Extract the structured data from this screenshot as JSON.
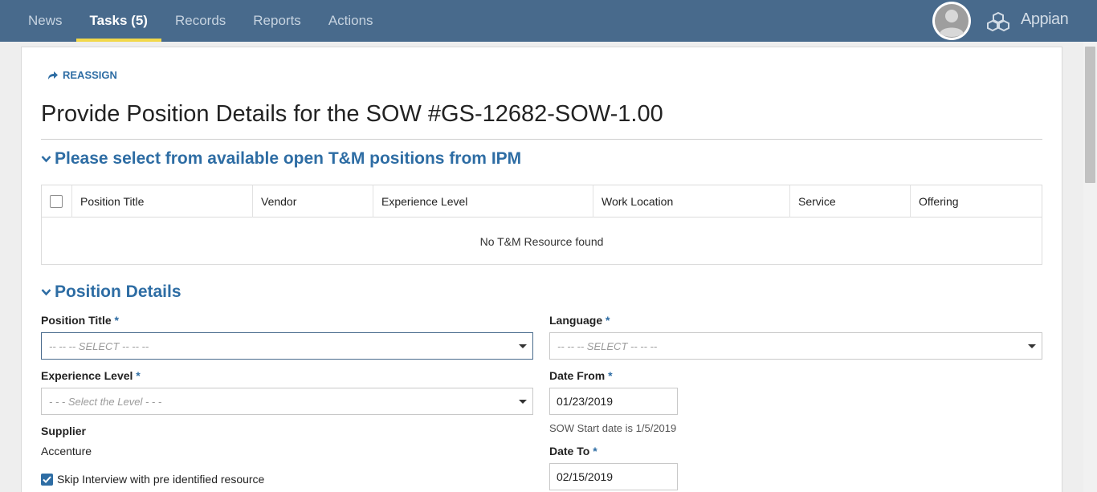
{
  "nav": {
    "tabs": [
      {
        "label": "News"
      },
      {
        "label": "Tasks (5)"
      },
      {
        "label": "Records"
      },
      {
        "label": "Reports"
      },
      {
        "label": "Actions"
      }
    ],
    "active_tab": "Tasks (5)",
    "logo": "Appian"
  },
  "task": {
    "reassign_label": "REASSIGN",
    "title": "Provide Position Details for the SOW #GS-12682-SOW-1.00"
  },
  "ipm_section": {
    "heading": "Please select from available open T&M positions from IPM",
    "columns": [
      "Position Title",
      "Vendor",
      "Experience Level",
      "Work Location",
      "Service",
      "Offering"
    ],
    "empty_message": "No T&M Resource found"
  },
  "details_section": {
    "heading": "Position Details",
    "required_marker": "*",
    "position_title": {
      "label": "Position Title",
      "placeholder": "-- -- -- SELECT -- -- --"
    },
    "experience_level": {
      "label": "Experience Level",
      "placeholder": "- - - Select the Level - - -"
    },
    "supplier": {
      "label": "Supplier",
      "value": "Accenture"
    },
    "skip_interview": {
      "label": "Skip Interview with pre identified resource",
      "checked": true
    },
    "language": {
      "label": "Language",
      "placeholder": "-- -- -- SELECT -- -- --"
    },
    "date_from": {
      "label": "Date From",
      "value": "01/23/2019",
      "help": "SOW Start date is 1/5/2019"
    },
    "date_to": {
      "label": "Date To",
      "value": "02/15/2019"
    }
  },
  "colors": {
    "header_bg": "#486a8c",
    "accent": "#2e6da4",
    "active_underline": "#f2d84a"
  }
}
